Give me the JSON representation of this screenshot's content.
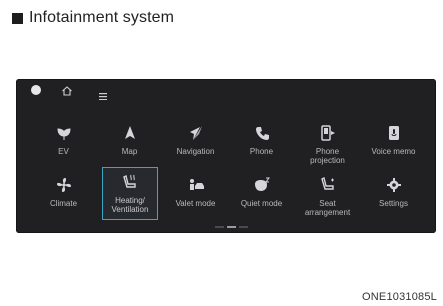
{
  "heading": "Infotainment system",
  "figure_code": "ONE1031085L",
  "apps": [
    {
      "label": "EV",
      "icon": "leaf-icon"
    },
    {
      "label": "Map",
      "icon": "navigation-arrow-icon"
    },
    {
      "label": "Navigation",
      "icon": "compass-icon"
    },
    {
      "label": "Phone",
      "icon": "phone-icon"
    },
    {
      "label": "Phone\nprojection",
      "icon": "phone-projection-icon"
    },
    {
      "label": "Voice memo",
      "icon": "voice-memo-icon"
    },
    {
      "label": "Climate",
      "icon": "fan-icon"
    },
    {
      "label": "Heating/\nVentilation",
      "icon": "heated-seat-icon",
      "selected": true
    },
    {
      "label": "Valet mode",
      "icon": "valet-icon"
    },
    {
      "label": "Quiet mode",
      "icon": "quiet-mode-icon"
    },
    {
      "label": "Seat\narrangement",
      "icon": "seat-icon"
    },
    {
      "label": "Settings",
      "icon": "gear-icon"
    }
  ],
  "colors": {
    "screen_bg": "#202022",
    "icon": "#d6d6da",
    "selected_border": "#3aa6c6"
  }
}
